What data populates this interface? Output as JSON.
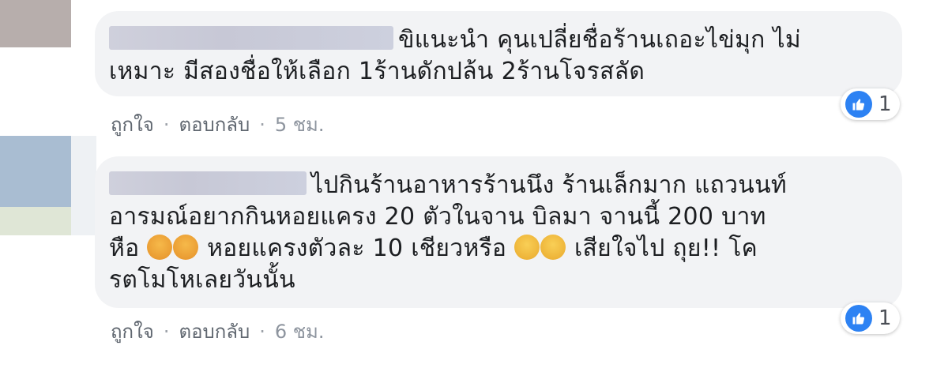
{
  "comments": [
    {
      "text_line1": "ขิแนะนำ คุนเปลี่ยชื่อร้านเถอะไข่มุก ไม่",
      "text_line2": "เหมาะ มีสองชื่อให้เลือก 1ร้านดักปล้น 2ร้านโจรสลัด",
      "reaction_count": "1",
      "like_label": "ถูกใจ",
      "reply_label": "ตอบกลับ",
      "time": "5 ชม."
    },
    {
      "text_line1": "ไปกินร้านอาหารร้านนึง ร้านเล็กมาก แถวนนท์",
      "text_line2": "อารมณ์อยากกินหอยแครง 20 ตัวในจาน บิลมา จานนี้ 200 บาท",
      "text_line3_a": "หือ",
      "text_line3_b": "หอยแครงตัวละ 10 เชียวหรือ",
      "text_line3_c": "เสียใจไป ถุย!! โค",
      "text_line4": "รตโมโหเลยวันนั้น",
      "reaction_count": "1",
      "like_label": "ถูกใจ",
      "reply_label": "ตอบกลับ",
      "time": "6 ชม."
    }
  ],
  "separator": "·",
  "colors": {
    "bubble": "#f2f3f5",
    "like_blue": "#2d82f3",
    "meta_text": "#8d949e"
  },
  "icons": {
    "like": "thumbs-up-icon",
    "angry": "angry-face-emoji",
    "laugh": "tears-of-joy-emoji"
  }
}
